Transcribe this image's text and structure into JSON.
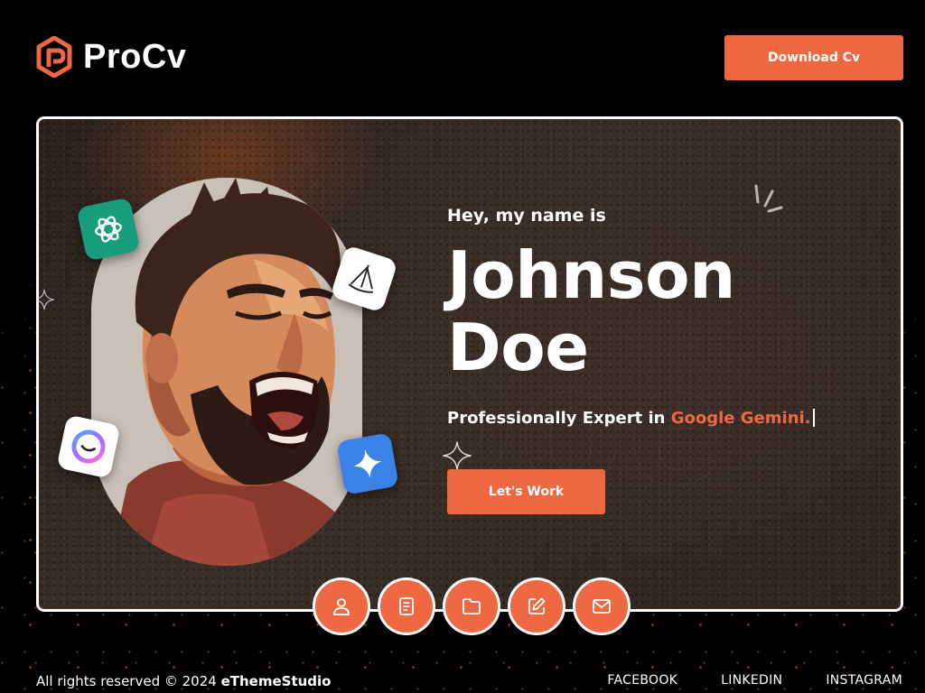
{
  "brand": {
    "name": "ProCv",
    "icon": "procv-logo-icon",
    "accent_color": "#ee6942"
  },
  "header": {
    "download_label": "Download Cv"
  },
  "hero": {
    "greeting": "Hey, my name is",
    "first_name": "Johnson",
    "last_name": "Doe",
    "tagline_prefix": "Professionally Expert in ",
    "tagline_highlight": "Google Gemini.",
    "cta_label": "Let's Work",
    "portrait": "shouting-man-illustration",
    "floating_badges": [
      "chatgpt-icon",
      "sailboat-app-icon",
      "smile-app-icon",
      "gemini-star-icon"
    ]
  },
  "section_nav": [
    {
      "name": "about",
      "icon": "user-icon"
    },
    {
      "name": "resume",
      "icon": "document-icon"
    },
    {
      "name": "portfolio",
      "icon": "folder-icon"
    },
    {
      "name": "blog",
      "icon": "edit-icon"
    },
    {
      "name": "contact",
      "icon": "mail-icon"
    }
  ],
  "footer": {
    "copyright_prefix": "All rights reserved © 2024 ",
    "copyright_owner": "eThemeStudio",
    "social": [
      "FACEBOOK",
      "LINKEDIN",
      "INSTAGRAM"
    ]
  }
}
